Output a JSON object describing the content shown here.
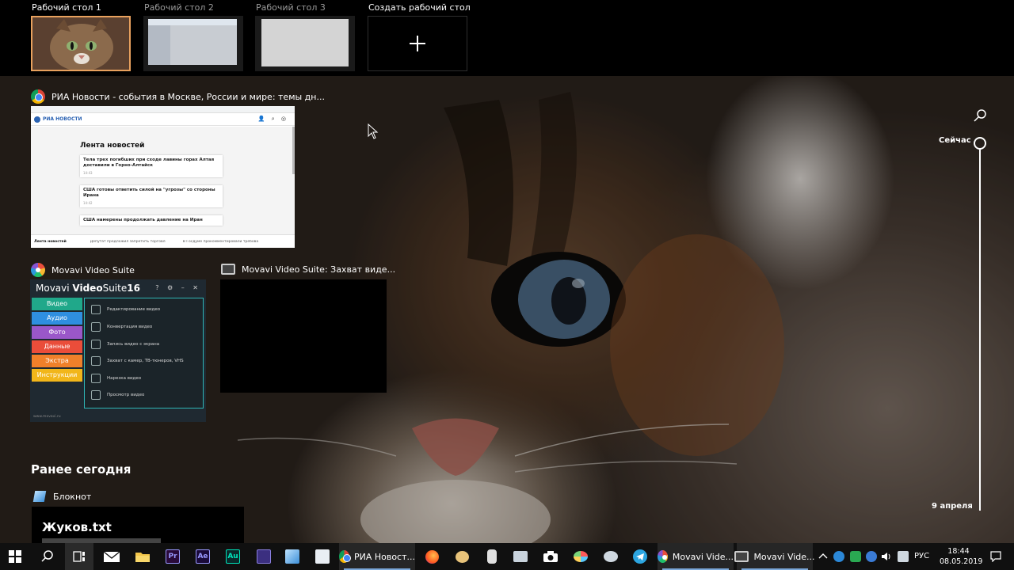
{
  "desktops": [
    {
      "label": "Рабочий стол 1",
      "active": true
    },
    {
      "label": "Рабочий стол 2",
      "active": false
    },
    {
      "label": "Рабочий стол 3",
      "active": false
    }
  ],
  "new_desktop_label": "Создать рабочий стол",
  "windows": {
    "ria": {
      "title": "РИА Новости - события в Москве, России и мире: темы дн...",
      "logo": "РИА НОВОСТИ",
      "feed_title": "Лента новостей",
      "news": [
        {
          "text": "Тела трех погибших при сходе лавины горах Алтая доставили в Горно-Алтайск",
          "meta": "14:43"
        },
        {
          "text": "США готовы ответить силой на \"угрозы\" со стороны Ирана",
          "meta": "14:42"
        },
        {
          "text": "США намерены продолжать давление на Иран",
          "meta": ""
        }
      ],
      "bottom": [
        "Лента новостей",
        "Депутат предложил запретить торговлю крепким алкоголем",
        "В Госдуме прокомментировали требования Ирана"
      ]
    },
    "movavi": {
      "title": "Movavi Video Suite",
      "brand_light": "Movavi ",
      "brand_bold": "Video",
      "brand_suite": "Suite",
      "brand_num": "16",
      "controls": "? ⚙ – ✕",
      "tabs": [
        {
          "label": "Видео",
          "color": "#20a88a"
        },
        {
          "label": "Аудио",
          "color": "#2f8fe0"
        },
        {
          "label": "Фото",
          "color": "#9a57c9"
        },
        {
          "label": "Данные",
          "color": "#ea4d3a"
        },
        {
          "label": "Экстра",
          "color": "#f0802a"
        },
        {
          "label": "Инструкции",
          "color": "#f2b61a"
        }
      ],
      "items": [
        "Редактирование видео",
        "Конвертация видео",
        "Запись видео с экрана",
        "Захват с камер, ТВ-тюнеров, VHS",
        "Нарезка видео",
        "Просмотр видео"
      ],
      "footer": "www.movavi.ru"
    },
    "capture": {
      "title": "Movavi Video Suite: Захват виде..."
    }
  },
  "timeline": {
    "now_label": "Сейчас",
    "date_label": "9 апреля"
  },
  "earlier": {
    "heading": "Ранее сегодня",
    "app_name": "Блокнот",
    "file_name": "Жуков.txt"
  },
  "taskbar": {
    "apps": [
      {
        "name": "start",
        "icon": "windows-icon"
      },
      {
        "name": "search",
        "icon": "search-icon"
      },
      {
        "name": "task-view",
        "icon": "task-view-icon"
      },
      {
        "name": "mail",
        "icon": "mail-icon"
      },
      {
        "name": "explorer",
        "icon": "folder-icon"
      },
      {
        "name": "premiere",
        "label": "Pr",
        "color": "#9999ff",
        "bg": "#2a0a3a"
      },
      {
        "name": "after-effects",
        "label": "Ae",
        "color": "#9999ff",
        "bg": "#1a0a3a"
      },
      {
        "name": "audition",
        "label": "Au",
        "color": "#00e4bb",
        "bg": "#0a2a2a"
      }
    ],
    "running": [
      {
        "label": "РИА Новост..."
      },
      {
        "label": "Movavi Vide..."
      },
      {
        "label": "Movavi Vide..."
      }
    ],
    "language": "РУС",
    "time": "18:44",
    "date": "08.05.2019"
  }
}
